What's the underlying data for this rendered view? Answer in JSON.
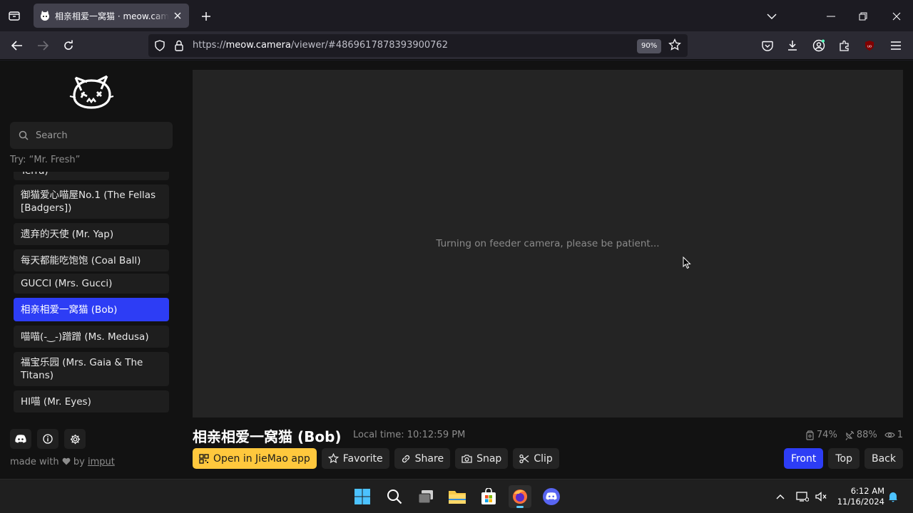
{
  "browser": {
    "tab_title": "相亲相爱一窝猫 · meow.camera",
    "url_prefix": "https://",
    "url_host": "meow.camera",
    "url_path": "/viewer/#4869617878393900762",
    "zoom": "90%",
    "accent": "#2d3df5"
  },
  "sidebar": {
    "search_placeholder": "Search",
    "hint": "Try: “Mr. Fresh”",
    "items": [
      {
        "label": "Terra)"
      },
      {
        "label": "御猫爱心喵屋No.1 (The Fellas [Badgers])"
      },
      {
        "label": "遗弃的天使 (Mr. Yap)"
      },
      {
        "label": "每天都能吃饱饱 (Coal Ball)"
      },
      {
        "label": "GUCCI (Mrs. Gucci)"
      },
      {
        "label": "相亲相爱一窝猫 (Bob)"
      },
      {
        "label": "喵喵(-‿-)蹭蹭 (Ms. Medusa)"
      },
      {
        "label": "福宝乐园 (Mrs. Gaia & The Titans)"
      },
      {
        "label": "HI喵 (Mr. Eyes)"
      }
    ],
    "made_with_prefix": "made with",
    "made_with_by": "by",
    "made_with_author": "imput"
  },
  "viewer": {
    "status": "Turning on feeder camera, please be patient..."
  },
  "camera": {
    "name": "相亲相爱一窝猫 (Bob)",
    "local_time": "Local time: 10:12:59 PM",
    "food_level": "74%",
    "signal": "88%",
    "viewers": "1"
  },
  "actions": {
    "open_app": "Open in JieMao app",
    "favorite": "Favorite",
    "share": "Share",
    "snap": "Snap",
    "clip": "Clip"
  },
  "views": {
    "front": "Front",
    "top": "Top",
    "back": "Back"
  },
  "taskbar": {
    "time": "6:12 AM",
    "date": "11/16/2024"
  }
}
